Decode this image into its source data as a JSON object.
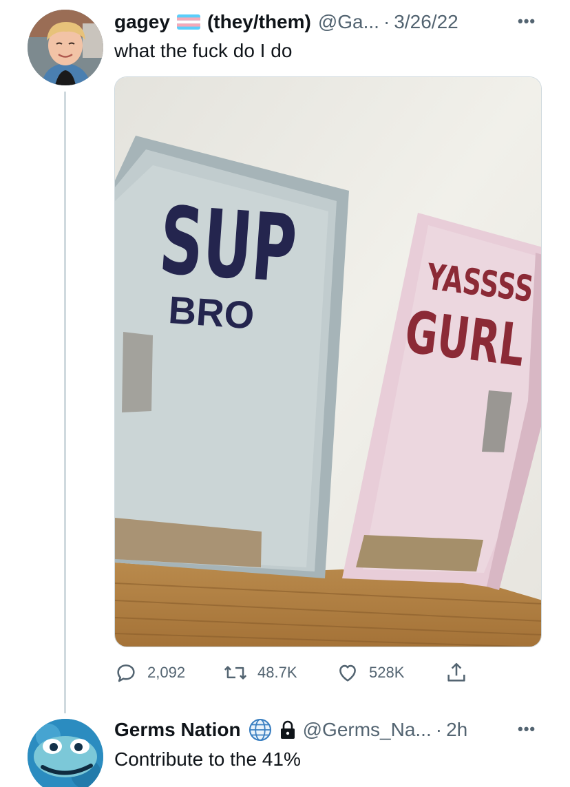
{
  "tweet": {
    "author_name": "gagey",
    "author_pronouns": "(they/them)",
    "handle": "@Ga...",
    "separator": "·",
    "date": "3/26/22",
    "text": "what the fuck do I do",
    "photo": {
      "left_door_top": "SUP",
      "left_door_bottom": "BRO",
      "right_door_top": "YASSSS",
      "right_door_bottom": "GURL"
    },
    "actions": {
      "replies": "2,092",
      "retweets": "48.7K",
      "likes": "528K"
    },
    "flag_icon": "transgender-flag-icon"
  },
  "reply": {
    "author_name": "Germs Nation",
    "handle": "@Germs_Na...",
    "separator": "·",
    "time": "2h",
    "text": "Contribute to the 41%",
    "badge_icons": [
      "globe-icon",
      "lock-icon"
    ]
  },
  "colors": {
    "text_primary": "#0f1419",
    "text_secondary": "#536471",
    "thread_line": "#cfd9de",
    "trans_blue": "#5bcefa",
    "trans_pink": "#f5a9b8"
  }
}
